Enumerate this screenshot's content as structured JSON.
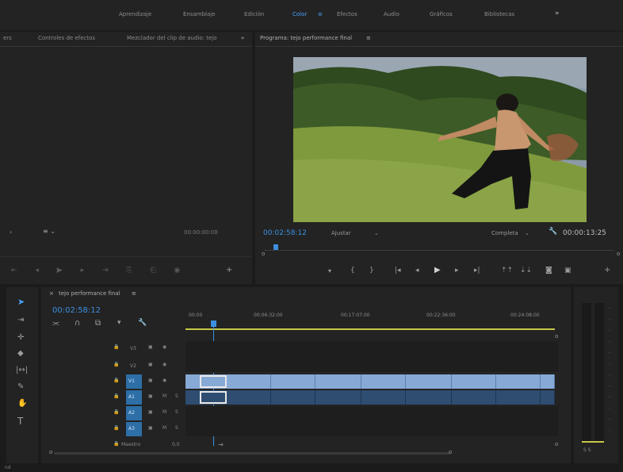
{
  "workspaces": [
    {
      "label": "Aprendizaje"
    },
    {
      "label": "Ensamblaje"
    },
    {
      "label": "Edición"
    },
    {
      "label": "Color"
    },
    {
      "label": "Efectos"
    },
    {
      "label": "Audio"
    },
    {
      "label": "Gráficos"
    },
    {
      "label": "Bibliotecas"
    },
    {
      "label": "»"
    }
  ],
  "source_panel": {
    "tabs": [
      "Controles de efectos",
      "Mezclador del clip de audio: tejo"
    ],
    "timecode": "00:00:00:00"
  },
  "program_panel": {
    "title": "Programa: tejo performance final",
    "current_timecode": "00:02:58:12",
    "fit_label": "Ajustar",
    "quality_label": "Completa",
    "duration_timecode": "00:00:13:25"
  },
  "timeline": {
    "sequence_name": "tejo performance final",
    "timecode": "00:02:58:12",
    "ruler": [
      "00:00",
      "00:06:32:00",
      "00:17:07:00",
      "00:22:36:00",
      "00:24:08:00"
    ],
    "video_tracks": [
      "V3",
      "V2",
      "V1"
    ],
    "audio_tracks": [
      "A1",
      "A2",
      "A3"
    ],
    "master_label": "Maestro",
    "master_value": "0,0"
  },
  "status_text": "nd"
}
